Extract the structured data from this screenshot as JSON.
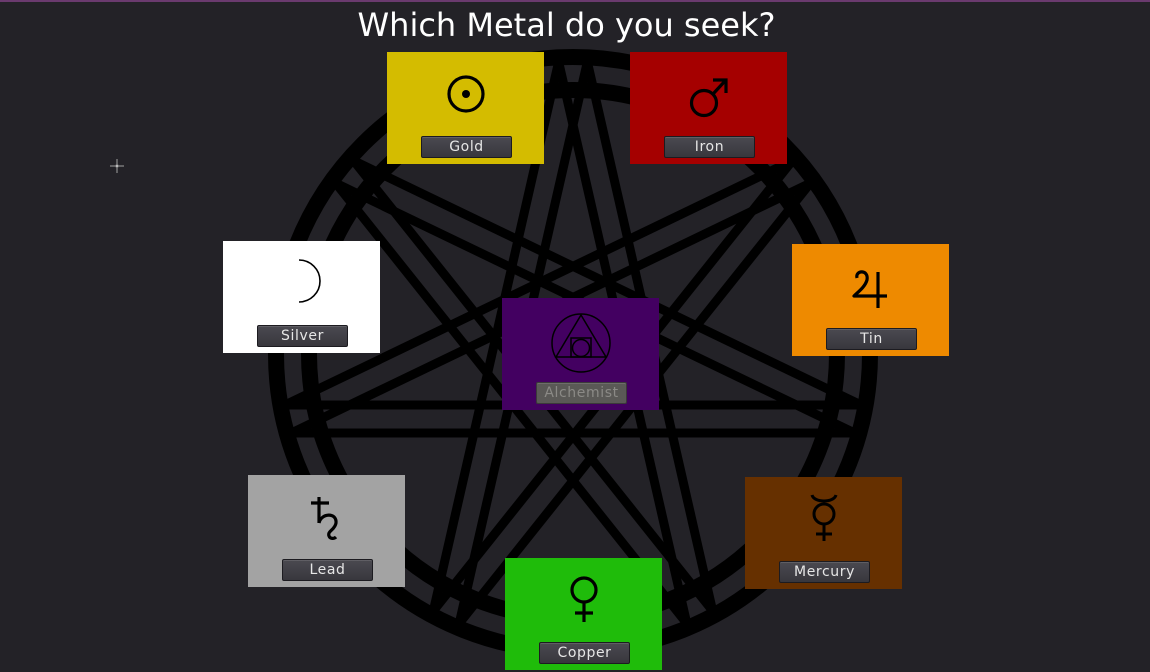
{
  "title": "Which Metal do you seek?",
  "colors": {
    "background": "#232227",
    "seal": "#000000",
    "gold": "#d4bc00",
    "iron": "#a50000",
    "silver": "#ffffff",
    "tin": "#ee8a00",
    "alchemist": "#430061",
    "lead": "#a3a3a3",
    "mercury": "#663000",
    "copper": "#1fbc0a"
  },
  "metals": [
    {
      "key": "gold",
      "label": "Gold",
      "symbol": "sun-icon"
    },
    {
      "key": "iron",
      "label": "Iron",
      "symbol": "mars-icon"
    },
    {
      "key": "silver",
      "label": "Silver",
      "symbol": "moon-icon"
    },
    {
      "key": "tin",
      "label": "Tin",
      "symbol": "jupiter-icon"
    },
    {
      "key": "alchemist",
      "label": "Alchemist",
      "symbol": "philosophers-stone-icon",
      "disabled": true
    },
    {
      "key": "lead",
      "label": "Lead",
      "symbol": "saturn-icon"
    },
    {
      "key": "mercury",
      "label": "Mercury",
      "symbol": "mercury-icon"
    },
    {
      "key": "copper",
      "label": "Copper",
      "symbol": "venus-icon"
    }
  ]
}
